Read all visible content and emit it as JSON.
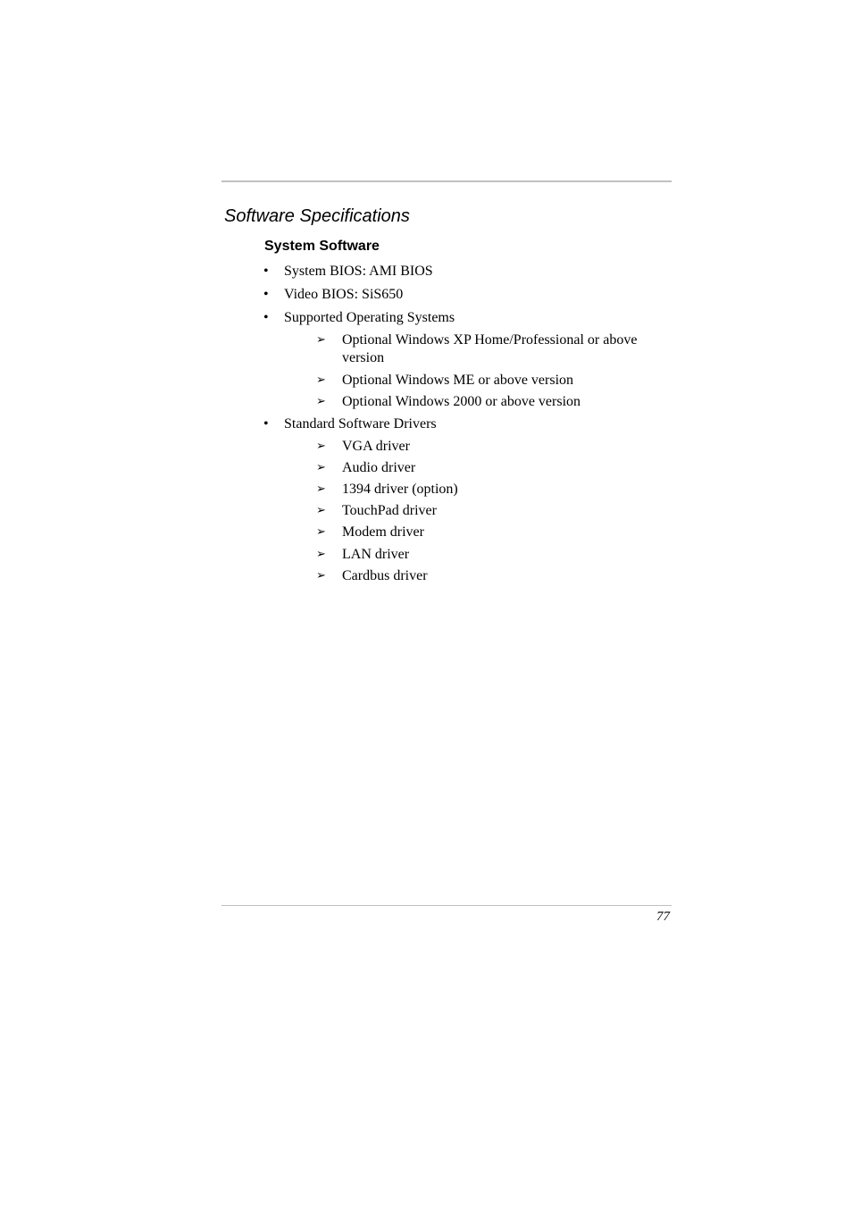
{
  "section_title": "Software Specifications",
  "subsection_title": "System Software",
  "bullets": [
    {
      "text": "System BIOS: AMI BIOS"
    },
    {
      "text": "Video BIOS: SiS650"
    },
    {
      "text": "Supported Operating Systems",
      "subitems": [
        "Optional Windows XP Home/Professional or above",
        "version",
        "Optional Windows ME or above version",
        "Optional Windows 2000 or above version"
      ]
    },
    {
      "text": "Standard Software Drivers",
      "subitems": [
        "VGA driver",
        "Audio driver",
        "1394 driver (option)",
        "TouchPad driver",
        "Modem driver",
        "LAN driver",
        "Cardbus driver"
      ]
    }
  ],
  "icons": {
    "bullet": "•",
    "arrow": "➢"
  },
  "page_number": "77"
}
